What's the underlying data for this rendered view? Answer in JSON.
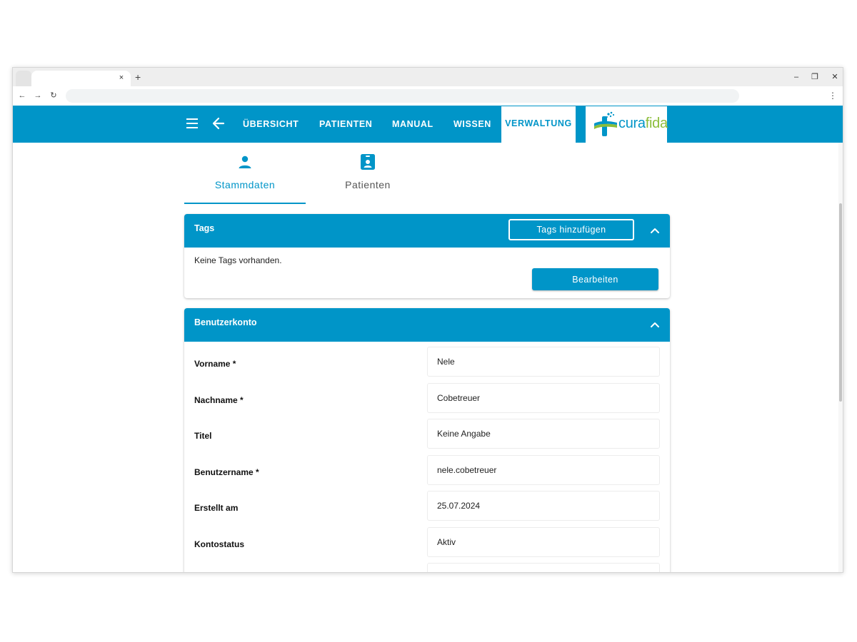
{
  "browser": {
    "tab_close": "×",
    "new_tab": "+",
    "window_controls": [
      "–",
      "❐",
      "✕"
    ],
    "nav": [
      "←",
      "→",
      "↻"
    ],
    "menu": "⋮"
  },
  "appbar": {
    "nav_items": [
      "ÜBERSICHT",
      "PATIENTEN",
      "MANUAL",
      "WISSEN",
      "VERWALTUNG"
    ],
    "active_item": "VERWALTUNG",
    "logo": {
      "part1": "cura",
      "part2": "fida"
    },
    "colors": {
      "primary": "#0095c8",
      "logo_green": "#8cbd3a"
    }
  },
  "subtabs": {
    "items": [
      {
        "label": "Stammdaten",
        "icon": "person-icon"
      },
      {
        "label": "Patienten",
        "icon": "badge-icon"
      }
    ],
    "active": "Stammdaten"
  },
  "tags_card": {
    "title": "Tags",
    "add_button": "Tags hinzufügen",
    "empty_text": "Keine Tags vorhanden.",
    "edit_button": "Bearbeiten"
  },
  "account_card": {
    "title": "Benutzerkonto",
    "fields": [
      {
        "label": "Vorname *",
        "value": "Nele"
      },
      {
        "label": "Nachname *",
        "value": "Cobetreuer"
      },
      {
        "label": "Titel",
        "value": "Keine Angabe"
      },
      {
        "label": "Benutzername *",
        "value": "nele.cobetreuer"
      },
      {
        "label": "Erstellt am",
        "value": "25.07.2024"
      },
      {
        "label": "Kontostatus",
        "value": "Aktiv"
      }
    ]
  }
}
